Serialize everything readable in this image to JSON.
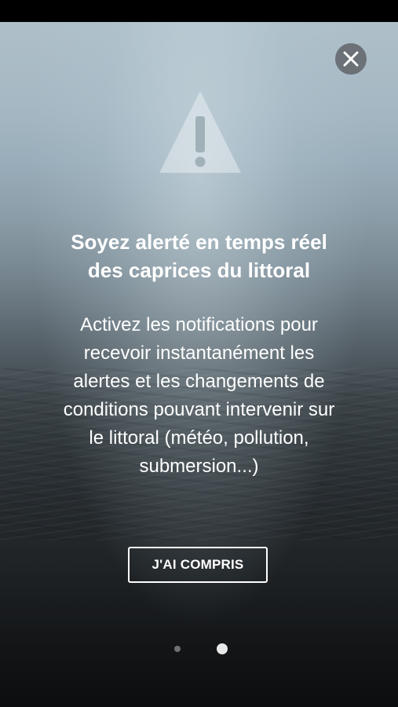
{
  "onboarding": {
    "headline_lines": [
      "Soyez alerté en temps réel",
      "des caprices du littoral"
    ],
    "body_lines": [
      "Activez les notifications pour",
      "recevoir instantanément les",
      "alertes et les changements de",
      "conditions pouvant intervenir sur",
      "le littoral (météo, pollution,",
      "submersion...)"
    ],
    "button_label": "J'AI COMPRIS",
    "pagination": {
      "current_page": 2,
      "total_pages": 2
    },
    "icons": {
      "close": "close-icon",
      "hero": "warning-icon"
    },
    "colors": {
      "text": "#ffffff",
      "dot_active": "#e8e8e8",
      "dot_inactive": "#6f7275"
    }
  }
}
